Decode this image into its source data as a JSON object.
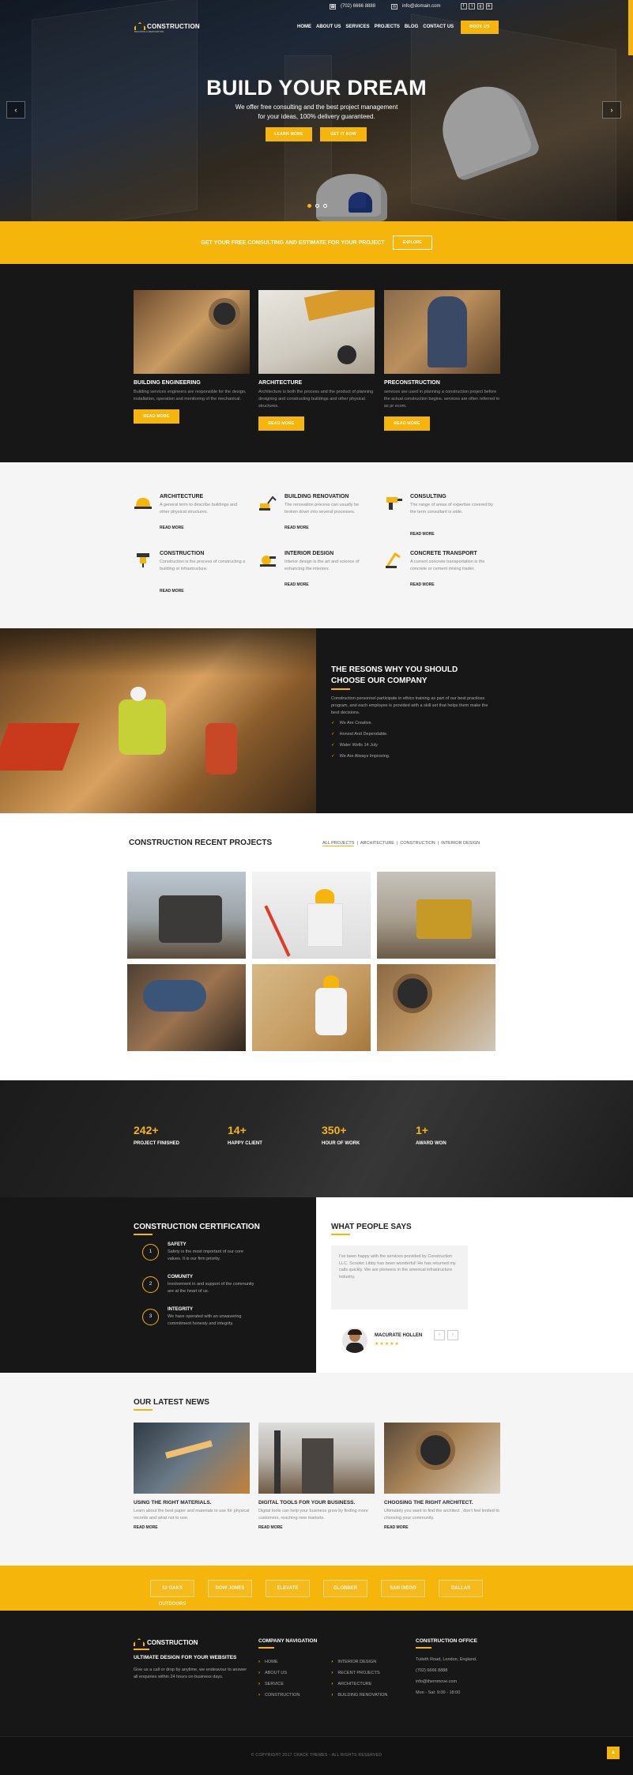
{
  "topbar": {
    "phone": "(702) 6666 8888",
    "email": "info@domain.com",
    "social": [
      "f",
      "t",
      "g",
      "in"
    ]
  },
  "header": {
    "logo": "CONSTRUCTION",
    "logo_sub": "BUILDING & RENOVATION",
    "nav": [
      "HOME",
      "ABOUT US",
      "SERVICES",
      "PROJECTS",
      "BLOG",
      "CONTACT US"
    ],
    "book_button": "BOOK US"
  },
  "hero": {
    "title": "BUILD YOUR DREAM",
    "subtitle_line1": "We offer free consulting and the best project management",
    "subtitle_line2": "for your ideas, 100% delivery guaranteed.",
    "btn_learn": "LEARN MORE",
    "btn_get": "GET IT NOW"
  },
  "cta": {
    "text": "GET YOUR FREE CONSULTING AND ESTIMATE FOR YOUR PROJECT",
    "button": "EXPLORE"
  },
  "services": [
    {
      "title": "BUILDING ENGINEERING",
      "text": "Building services engineers are responsible for the design, installation, operation and monitoring of the mechanical.",
      "button": "READ MORE"
    },
    {
      "title": "ARCHITECTURE",
      "text": "Architecture is both the process and the product of planning designing and constructing buildings and other physical structures.",
      "button": "READ MORE"
    },
    {
      "title": "PRECONSTRUCTION",
      "text": "services are used in planning a construction project before the actual construction begins. services are often referred to as pr ecom.",
      "button": "READ MORE"
    }
  ],
  "features": [
    {
      "title": "ARCHITECTURE",
      "text": "A general term to describe buildings and other physical structures.",
      "more": "READ MORE"
    },
    {
      "title": "BUILDING RENOVATION",
      "text": "The renovation process can usually be broken down into several processes.",
      "more": "READ MORE"
    },
    {
      "title": "CONSULTING",
      "text": "The range of areas of expertise covered by the term consultant is wide.",
      "more": "READ MORE"
    },
    {
      "title": "CONSTRUCTION",
      "text": "Construction is the process of constructing a building or infrastructure.",
      "more": "READ MORE"
    },
    {
      "title": "INTERIOR DESIGN",
      "text": "Interior design is the art and science of enhancing the interiors.",
      "more": "READ MORE"
    },
    {
      "title": "CONCRETE TRANSPORT",
      "text": "A current concrete transportation is the concrete or cement mixing trader.",
      "more": "READ MORE"
    }
  ],
  "reasons": {
    "title": "THE RESONS WHY YOU SHOULD CHOOSE OUR COMPANY",
    "text": "Construction personnel participate in ethics training as part of our best practices program, and each employee is provided with a skill set that helps them make the best decisions.",
    "items": [
      "We Are Creative.",
      "Honest And Dependable.",
      "Water Wells 14 July",
      "We Are Always Improving."
    ]
  },
  "projects": {
    "title": "CONSTRUCTION RECENT PROJECTS",
    "tabs": [
      "ALL PROJECTS",
      "ARCHITECTURE",
      "CONSTRUCTION",
      "INTERIOR DESIGN"
    ]
  },
  "stats": [
    {
      "number": "242+",
      "label": "PROJECT FINISHED"
    },
    {
      "number": "14+",
      "label": "HAPPY CLIENT"
    },
    {
      "number": "350+",
      "label": "HOUR OF WORK"
    },
    {
      "number": "1+",
      "label": "AWARD WON"
    }
  ],
  "certification": {
    "title": "CONSTRUCTION CERTIFICATION",
    "items": [
      {
        "num": "1",
        "title": "SAFETY",
        "text": "Safety is the most important of our core values. It is our firm priority."
      },
      {
        "num": "2",
        "title": "COMUNITY",
        "text": "Involvement in and support of the community are at the heart of us."
      },
      {
        "num": "3",
        "title": "INTEGRITY",
        "text": "We have operated with an unwavering commitment honesty and integrity."
      }
    ]
  },
  "testimonial": {
    "title": "WHAT PEOPLE SAYS",
    "quote": "I've been happy with the services provided by Construction LLC. Scooter Libby has been wonderful! He has returned my calls quickly. We are pioneers in the americal infrastructure industry.",
    "name": "MACURATE HOLLEN",
    "stars": "★★★★★",
    "prev": "‹",
    "next": "›"
  },
  "news": {
    "title": "OUR LATEST NEWS",
    "items": [
      {
        "title": "USING THE RIGHT MATERIALS.",
        "text": "Learn about the best paper and materials to use for physical records and what not to use.",
        "more": "READ MORE"
      },
      {
        "title": "DIGITAL TOOLS FOR YOUR BUSINESS.",
        "text": "Digital tools can help your business grow by finding more customers, reaching new markets.",
        "more": "READ MORE"
      },
      {
        "title": "CHOOSING THE RIGHT ARCHITECT.",
        "text": "Ultimately you want to find the architect , don't feel limited to choosing your community.",
        "more": "READ MORE"
      }
    ]
  },
  "partners": [
    "12 OAKS OUTDOORS",
    "DOW JONES",
    "ELEVATE",
    "GLOBBER",
    "SAN DIEGO",
    "DALLAS"
  ],
  "footer": {
    "logo": "CONSTRUCTION",
    "tagline": "ULTIMATE DESIGN FOR YOUR WEBSITES",
    "about": "Give us a call or drop by anytime, we endeavour to answer all enquiries within 24 hours on business days.",
    "nav_title": "COMPANY NAVIGATION",
    "nav_col1": [
      "HOME",
      "ABOUT US",
      "SERVICE",
      "CONSTRUCTION"
    ],
    "nav_col2": [
      "INTERIOR DESIGN",
      "RECENT PROJECTS",
      "ARCHITECTURE",
      "BUILDING RENOVATION"
    ],
    "office_title": "CONSTRUCTION OFFICE",
    "office": [
      "Tuiteth Road, London, England.",
      "(702) 6666 8888",
      "info@themmove.com",
      "Mon - Sat: 9:00 - 18:00"
    ],
    "copyright": "© COPYRIGHT 2017 CRACK THEMES - ALL RIGHTS RESERVED",
    "up": "▲"
  },
  "colors": {
    "accent": "#f5b50a",
    "dark": "#171717"
  }
}
